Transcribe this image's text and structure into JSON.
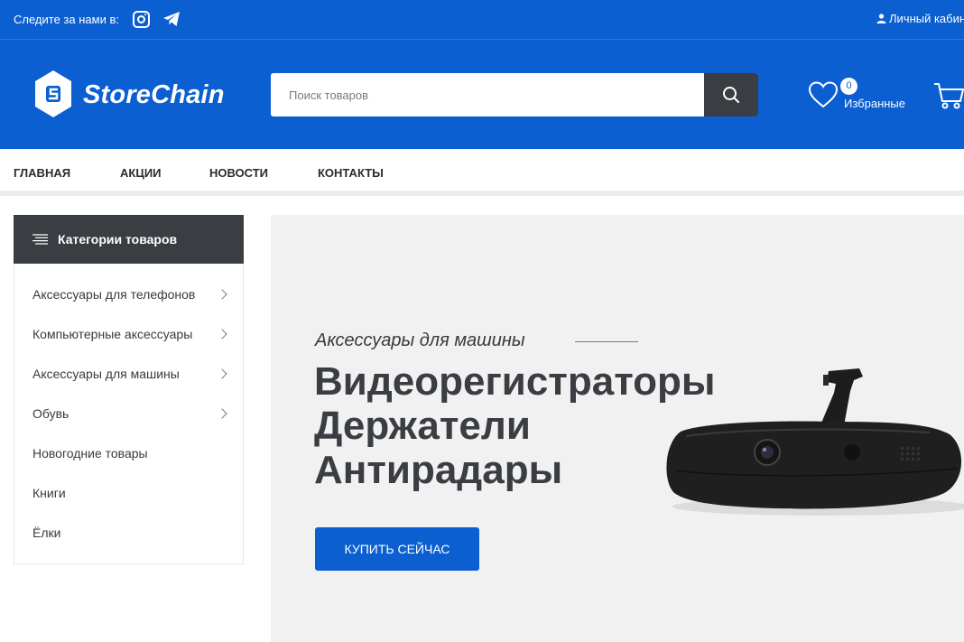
{
  "topbar": {
    "follow_label": "Следите за нами в:",
    "socials": [
      "instagram-icon",
      "telegram-icon"
    ],
    "account_label": "Личный кабинет"
  },
  "header": {
    "logo_text": "StoreChain",
    "search_placeholder": "Поиск товаров",
    "favorites_count": "0",
    "favorites_label": "Избранные"
  },
  "nav": {
    "items": [
      "ГЛАВНАЯ",
      "АКЦИИ",
      "НОВОСТИ",
      "КОНТАКТЫ"
    ]
  },
  "categories": {
    "title": "Категории товаров",
    "items": [
      {
        "label": "Аксессуары для телефонов",
        "has_children": true
      },
      {
        "label": "Компьютерные аксессуары",
        "has_children": true
      },
      {
        "label": "Аксессуары для машины",
        "has_children": true
      },
      {
        "label": "Обувь",
        "has_children": true
      },
      {
        "label": "Новогодние товары",
        "has_children": false
      },
      {
        "label": "Книги",
        "has_children": false
      },
      {
        "label": "Ёлки",
        "has_children": false
      }
    ]
  },
  "banner": {
    "eyebrow": "Аксессуары для машины",
    "headline": [
      "Видеорегистраторы",
      "Держатели",
      "Антирадары"
    ],
    "cta_label": "КУПИТЬ СЕЙЧАС"
  },
  "colors": {
    "brand_blue": "#0b5fd1",
    "dark": "#3a3d42",
    "banner_bg": "#f1f1f1"
  }
}
